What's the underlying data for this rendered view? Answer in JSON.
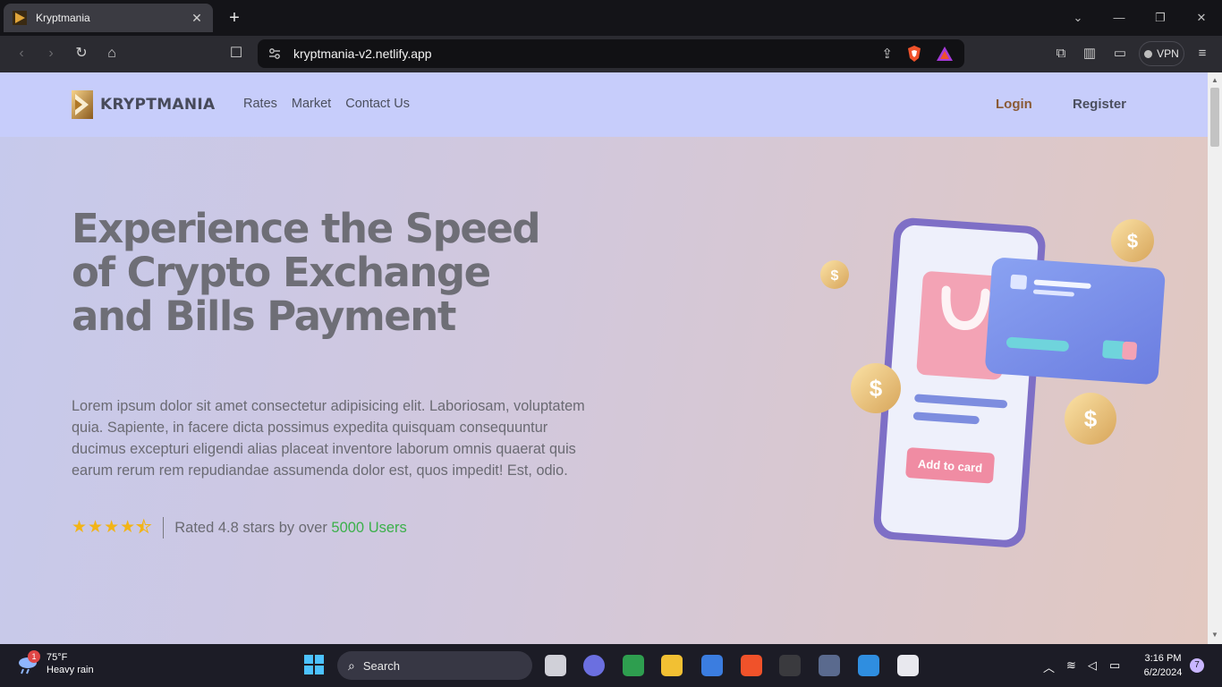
{
  "browser": {
    "tab_title": "Kryptmania",
    "url": "kryptmania-v2.netlify.app",
    "vpn_label": "VPN"
  },
  "site": {
    "logo_text": "KRYPTMANIA",
    "nav": [
      "Rates",
      "Market",
      "Contact Us"
    ],
    "login": "Login",
    "register": "Register"
  },
  "hero": {
    "title_lines": [
      "Experience the Speed",
      "of Crypto Exchange",
      "and Bills Payment"
    ],
    "description": "Lorem ipsum dolor sit amet consectetur adipisicing elit. Laboriosam, voluptatem quia. Sapiente, in facere dicta possimus expedita quisquam consequuntur ducimus excepturi eligendi alias placeat inventore laborum omnis quaerat quis earum rerum rem repudiandae assumenda dolor est, quos impedit! Est, odio.",
    "rating_value": 4.5,
    "rating_prefix": "Rated 4.8 stars by over ",
    "rating_count": "5000 Users",
    "illustration_button": "Add to card",
    "illustration_coin_symbol": "$"
  },
  "taskbar": {
    "weather_temp": "75°F",
    "weather_desc": "Heavy rain",
    "weather_badge": "1",
    "search_label": "Search",
    "time": "3:16 PM",
    "date": "6/2/2024",
    "notifications": "7"
  },
  "colors": {
    "accent_login": "#8a5a35",
    "rating_green": "#3bb04a",
    "star": "#f2b416"
  }
}
